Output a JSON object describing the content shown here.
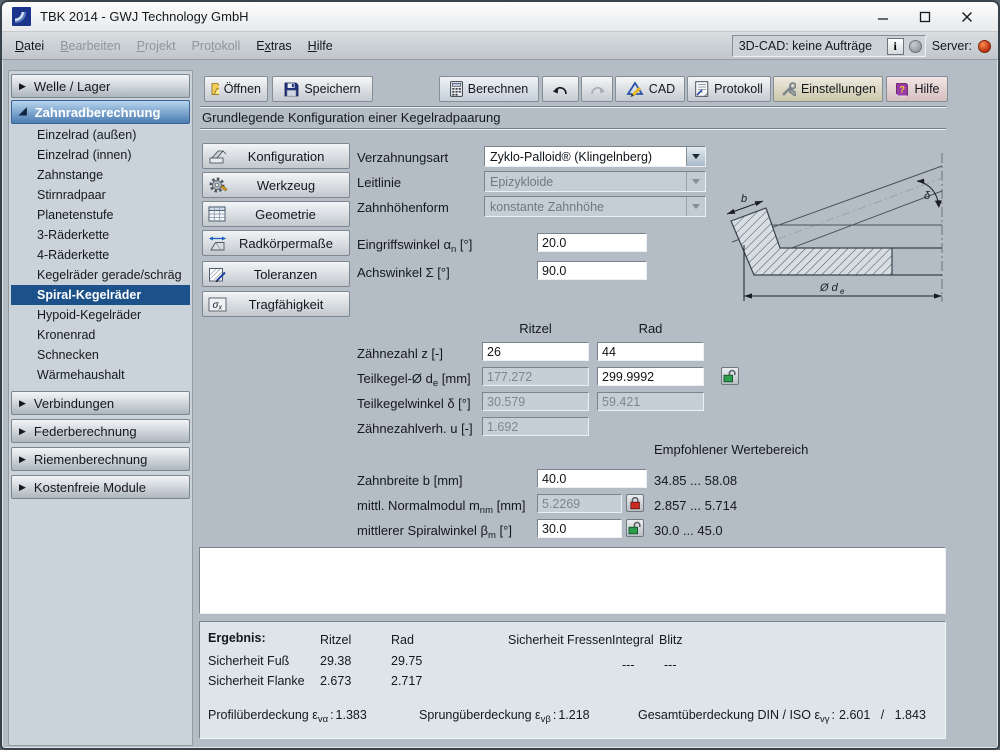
{
  "window": {
    "title": "TBK 2014 - GWJ Technology GmbH"
  },
  "icons": {
    "collapsed_arrow": "▶",
    "expanded_arrow": "◢"
  },
  "menubar": {
    "items": [
      {
        "pre": "",
        "key": "D",
        "post": "atei"
      },
      {
        "pre": "",
        "key": "B",
        "post": "earbeiten"
      },
      {
        "pre": "",
        "key": "P",
        "post": "rojekt"
      },
      {
        "pre": "Pro",
        "key": "t",
        "post": "okoll"
      },
      {
        "pre": "E",
        "key": "x",
        "post": "tras"
      },
      {
        "pre": "",
        "key": "H",
        "post": "ilfe"
      }
    ],
    "cad_status": "3D-CAD: keine Aufträge",
    "info": "i",
    "server_label": "Server:"
  },
  "toolbar": {
    "open": "Öffnen",
    "save": "Speichern",
    "calculate": "Berechnen",
    "cad": "CAD",
    "protocol": "Protokoll",
    "settings": "Einstellungen",
    "help": "Hilfe",
    "help_qmark": "?"
  },
  "heading": "Grundlegende Konfiguration einer Kegelradpaarung",
  "sidebar": {
    "welle": "Welle / Lager",
    "zahnrad": "Zahnradberechnung",
    "items": [
      "Einzelrad (außen)",
      "Einzelrad (innen)",
      "Zahnstange",
      "Stirnradpaar",
      "Planetenstufe",
      "3-Räderkette",
      "4-Räderkette",
      "Kegelräder gerade/schräg",
      "Spiral-Kegelräder",
      "Hypoid-Kegelräder",
      "Kronenrad",
      "Schnecken",
      "Wärmehaushalt"
    ],
    "verbindungen": "Verbindungen",
    "feder": "Federberechnung",
    "riemen": "Riemenberechnung",
    "kostenfrei": "Kostenfreie Module"
  },
  "nav": {
    "konfiguration": "Konfiguration",
    "werkzeug": "Werkzeug",
    "geometrie": "Geometrie",
    "radkoerper": "Radkörpermaße",
    "toleranzen": "Toleranzen",
    "tragfaehigkeit": "Tragfähigkeit",
    "sigma": "σ",
    "sigma_sub": "x"
  },
  "form": {
    "verzahnungsart_label": "Verzahnungsart",
    "verzahnungsart_value": "Zyklo-Palloid® (Klingelnberg)",
    "leitlinie_label": "Leitlinie",
    "leitlinie_value": "Epizykloide",
    "zahnhoehenform_label": "Zahnhöhenform",
    "zahnhoehenform_value": "konstante Zahnhöhe",
    "eingriffswinkel": {
      "pre": "Eingriffswinkel α",
      "sub": "n",
      "post": " [°]",
      "value": "20.0"
    },
    "achswinkel": {
      "label": "Achswinkel Σ [°]",
      "value": "90.0"
    },
    "col_ritzel": "Ritzel",
    "col_rad": "Rad",
    "zaehnezahl": {
      "label": "Zähnezahl z [-]",
      "ritzel": "26",
      "rad": "44"
    },
    "teilkegel": {
      "pre": "Teilkegel-Ø d",
      "sub": "e",
      "post": " [mm]",
      "ritzel": "177.272",
      "rad": "299.9992"
    },
    "teilkegelwinkel": {
      "label": "Teilkegelwinkel δ [°]",
      "ritzel": "30.579",
      "rad": "59.421"
    },
    "zaehnezahlverh": {
      "label": "Zähnezahlverh. u [-]",
      "value": "1.692"
    },
    "wertebereich": "Empfohlener Wertebereich",
    "zahnbreite": {
      "label": "Zahnbreite b [mm]",
      "value": "40.0",
      "range": "34.85 ... 58.08"
    },
    "normalmodul": {
      "pre": "mittl. Normalmodul m",
      "sub": "nm",
      "post": " [mm]",
      "value": "5.2269",
      "range": "2.857 ... 5.714"
    },
    "spiralwinkel": {
      "pre": "mittlerer Spiralwinkel β",
      "sub": "m",
      "post": " [°]",
      "value": "30.0",
      "range": "30.0 ... 45.0"
    }
  },
  "diagram": {
    "b": "b",
    "delta": "δ",
    "de_pre": "Ø d",
    "de_sub": "e"
  },
  "results": {
    "title": "Ergebnis:",
    "col_ritzel": "Ritzel",
    "col_rad": "Rad",
    "col_fressen": "Sicherheit Fressen",
    "col_integral": "Integral",
    "col_blitz": "Blitz",
    "fuss_label": "Sicherheit Fuß",
    "fuss_ritzel": "29.38",
    "fuss_rad": "29.75",
    "fressen_integral": "---",
    "fressen_blitz": "---",
    "flanke_label": "Sicherheit Flanke",
    "flanke_ritzel": "2.673",
    "flanke_rad": "2.717",
    "profil": {
      "pre": "Profilüberdeckung ε",
      "sub": "vα",
      "sep": ":",
      "value": "1.383"
    },
    "sprung": {
      "pre": "Sprungüberdeckung ε",
      "sub": "vβ",
      "sep": ":",
      "value": "1.218"
    },
    "gesamt": {
      "pre": "Gesamtüberdeckung DIN / ISO ε",
      "sub": "vγ",
      "sep": ":",
      "value": "2.601   /   1.843"
    }
  }
}
